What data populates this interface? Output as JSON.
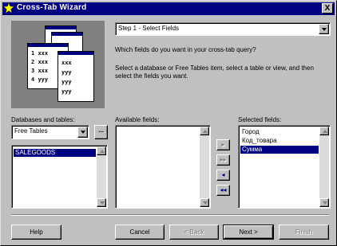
{
  "window": {
    "title": "Cross-Tab Wizard",
    "close_glyph": "X"
  },
  "icons": {
    "app": "wand-star-icon",
    "close": "close-icon",
    "dropdown": "chevron-down-icon",
    "ellipsis": "ellipsis-icon"
  },
  "illustration": {
    "rows": [
      {
        "n": "1",
        "a": "xxx",
        "b": "xxx"
      },
      {
        "n": "2",
        "a": "xxx",
        "b": "yyy"
      },
      {
        "n": "3",
        "a": "xxx",
        "b": "yyy"
      },
      {
        "n": "4",
        "a": "yyy",
        "b": "yyy"
      }
    ]
  },
  "step_select": {
    "value": "Step 1 - Select Fields"
  },
  "question": "Which fields do you want in your cross-tab query?",
  "instructions": "Select a database or Free Tables item, select a table or view, and then select the fields you want.",
  "databases": {
    "label": "Databases and tables:",
    "combo_value": "Free Tables",
    "ellipsis_label": "...",
    "tables": [
      "SALEGOODS"
    ],
    "selected_index": 0
  },
  "available_fields": {
    "label": "Available fields:",
    "items": []
  },
  "selected_fields": {
    "label": "Selected fields:",
    "items": [
      "Город",
      "Код_товара",
      "Сумма"
    ],
    "selected_index": 2
  },
  "move_buttons": {
    "add": "▸",
    "add_all": "▸▸",
    "remove": "◂",
    "remove_all": "◂◂"
  },
  "buttons": {
    "help": "Help",
    "cancel": "Cancel",
    "back": "< Back",
    "next": "Next >",
    "finish": "Finish"
  },
  "colors": {
    "titlebar": "#000080",
    "face": "#c0c0c0",
    "selection": "#000080"
  }
}
